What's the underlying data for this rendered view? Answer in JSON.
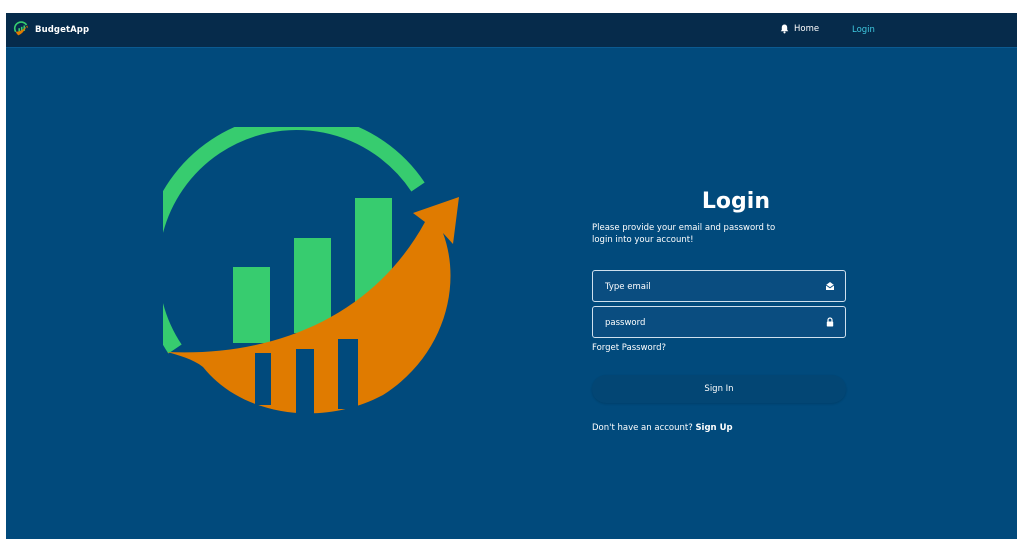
{
  "brand": {
    "name": "BudgetApp"
  },
  "nav": {
    "home_label": "Home",
    "login_label": "Login"
  },
  "login": {
    "title": "Login",
    "subtitle": "Please provide your email and password to login into your account!",
    "email_placeholder": "Type email",
    "password_placeholder": "password",
    "forget_label": "Forget Password?",
    "signin_label": "Sign In",
    "signup_prompt": "Don't have an account?",
    "signup_label": "Sign Up"
  },
  "icons": {
    "bell": "bell-icon",
    "email": "envelope-open-icon",
    "password": "lock-icon",
    "hero": "growth-chart-logo"
  },
  "colors": {
    "background": "#014a7c",
    "navbar": "#062b4b",
    "logo_green": "#37cc6f",
    "logo_orange": "#e07b00",
    "login_link": "#3fc8e0"
  }
}
